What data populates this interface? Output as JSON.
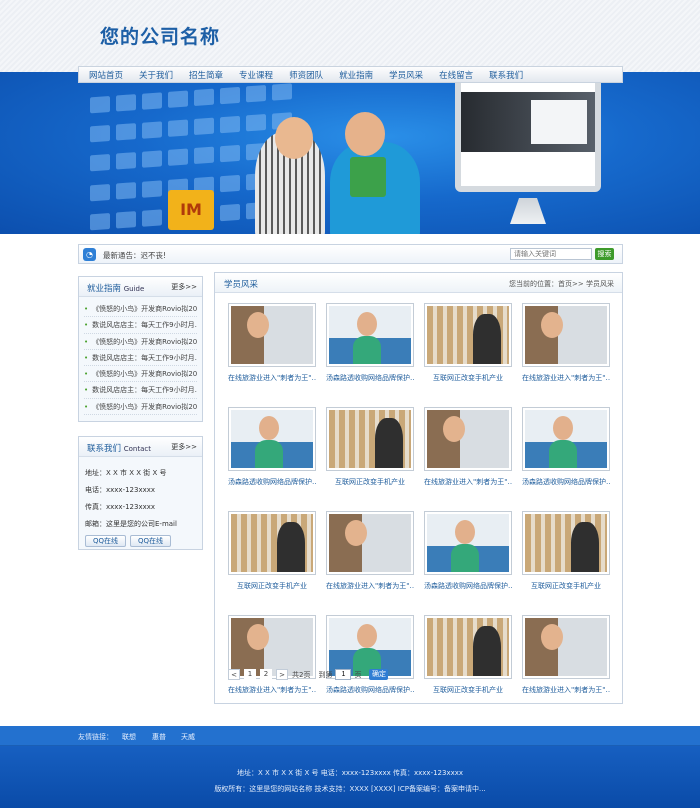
{
  "header": {
    "logo": "您的公司名称"
  },
  "nav": [
    "网站首页",
    "关于我们",
    "招生简章",
    "专业课程",
    "师资团队",
    "就业指南",
    "学员风采",
    "在线留言",
    "联系我们"
  ],
  "banner": {
    "box_text": "IM"
  },
  "notice": {
    "text": "最新通告：迟不丧!",
    "search_placeholder": "请输入关键词",
    "search_button": "搜索"
  },
  "job_guide": {
    "title": "就业指南",
    "subtitle": "Guide",
    "more": "更多>>",
    "items": [
      "《愤怒的小鸟》开发商Rovio拟20…",
      "数说风店店主：每天工作9小时月…",
      "《愤怒的小鸟》开发商Rovio拟20…",
      "数说风店店主：每天工作9小时月…",
      "《愤怒的小鸟》开发商Rovio拟20…",
      "数说风店店主：每天工作9小时月…",
      "《愤怒的小鸟》开发商Rovio拟20…"
    ]
  },
  "contact": {
    "title": "联系我们",
    "subtitle": "Contact",
    "more": "更多>>",
    "address": "地址：X X 市 X X 街 X 号",
    "phone": "电话：xxxx-123xxxx",
    "fax": "传真：xxxx-123xxxx",
    "email": "邮箱：这里是您的公司E-mail",
    "qq1": "QQ在线",
    "qq2": "QQ在线"
  },
  "main": {
    "title": "学员风采",
    "breadcrumb": "您当前的位置：首页>> 学员风采",
    "cards": [
      {
        "img": "a",
        "caption": "在线旅游业进入\"刺者为王\"…"
      },
      {
        "img": "b",
        "caption": "汤森路透收购网络品牌保护…"
      },
      {
        "img": "c",
        "caption": "互联网正改变手机产业"
      },
      {
        "img": "a",
        "caption": "在线旅游业进入\"刺者为王\"…"
      },
      {
        "img": "b",
        "caption": "汤森路透收购网络品牌保护…"
      },
      {
        "img": "c",
        "caption": "互联网正改变手机产业"
      },
      {
        "img": "a",
        "caption": "在线旅游业进入\"刺者为王\"…"
      },
      {
        "img": "b",
        "caption": "汤森路透收购网络品牌保护…"
      },
      {
        "img": "c",
        "caption": "互联网正改变手机产业"
      },
      {
        "img": "a",
        "caption": "在线旅游业进入\"刺者为王\"…"
      },
      {
        "img": "b",
        "caption": "汤森路透收购网络品牌保护…"
      },
      {
        "img": "c",
        "caption": "互联网正改变手机产业"
      },
      {
        "img": "a",
        "caption": "在线旅游业进入\"刺者为王\"…"
      },
      {
        "img": "b",
        "caption": "汤森路透收购网络品牌保护…"
      },
      {
        "img": "c",
        "caption": "互联网正改变手机产业"
      },
      {
        "img": "a",
        "caption": "在线旅游业进入\"刺者为王\"…"
      }
    ],
    "pager": {
      "prev": "<",
      "p1": "1",
      "p2": "2",
      "next": ">",
      "total": "共2页",
      "goto": "到第",
      "page_value": "1",
      "page_unit": "页",
      "go": "确定"
    }
  },
  "footer": {
    "links_label": "友情链接：",
    "links": [
      "联想",
      "惠普",
      "天威"
    ],
    "address_line": "地址：X X 市 X X 街 X 号  电话：xxxx-123xxxx  传真：xxxx-123xxxx",
    "copyright_line": "版权所有：这里是您的网站名称  技术支持：XXXX [XXXX] ICP备案编号：备案申请中..."
  },
  "colors": {
    "brand_blue": "#1d5fa6",
    "footer_blue": "#0a4ba8",
    "accent_green": "#3d9a2b"
  }
}
